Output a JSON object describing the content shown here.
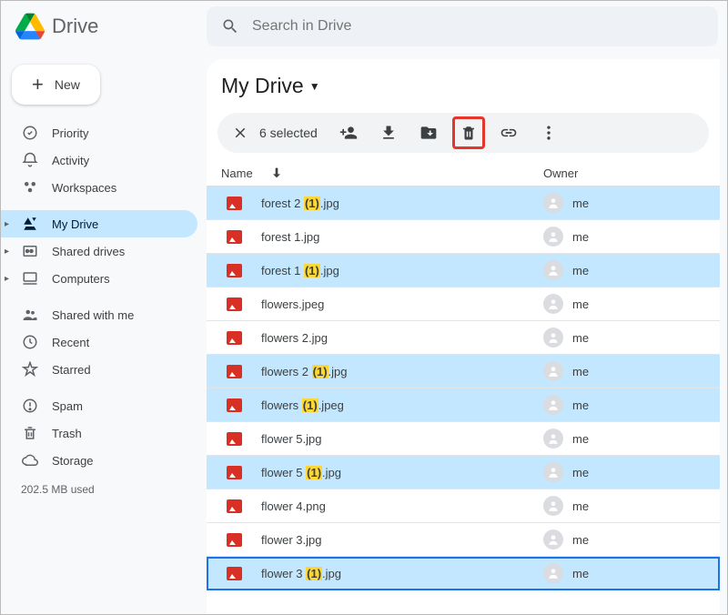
{
  "product_name": "Drive",
  "search_placeholder": "Search in Drive",
  "new_button": "New",
  "sidebar": {
    "items": [
      {
        "label": "Priority",
        "icon": "priority",
        "caret": false,
        "active": false
      },
      {
        "label": "Activity",
        "icon": "activity",
        "caret": false,
        "active": false
      },
      {
        "label": "Workspaces",
        "icon": "workspaces",
        "caret": false,
        "active": false
      },
      {
        "label": "My Drive",
        "icon": "mydrive",
        "caret": true,
        "active": true
      },
      {
        "label": "Shared drives",
        "icon": "shareddrives",
        "caret": true,
        "active": false
      },
      {
        "label": "Computers",
        "icon": "computers",
        "caret": true,
        "active": false
      },
      {
        "label": "Shared with me",
        "icon": "shared",
        "caret": false,
        "active": false
      },
      {
        "label": "Recent",
        "icon": "recent",
        "caret": false,
        "active": false
      },
      {
        "label": "Starred",
        "icon": "starred",
        "caret": false,
        "active": false
      },
      {
        "label": "Spam",
        "icon": "spam",
        "caret": false,
        "active": false
      },
      {
        "label": "Trash",
        "icon": "trash",
        "caret": false,
        "active": false
      },
      {
        "label": "Storage",
        "icon": "storage",
        "caret": false,
        "active": false
      }
    ],
    "storage_used": "202.5 MB used"
  },
  "page_title": "My Drive",
  "selection_bar": {
    "count_label": "6 selected"
  },
  "columns": {
    "name": "Name",
    "owner": "Owner"
  },
  "owner_self": "me",
  "files": [
    {
      "name_pre": "forest 2 ",
      "dup": "(1)",
      "name_post": ".jpg",
      "selected": true,
      "last": false
    },
    {
      "name_pre": "forest 1.jpg",
      "dup": "",
      "name_post": "",
      "selected": false,
      "last": false
    },
    {
      "name_pre": "forest 1 ",
      "dup": "(1)",
      "name_post": ".jpg",
      "selected": true,
      "last": false
    },
    {
      "name_pre": "flowers.jpeg",
      "dup": "",
      "name_post": "",
      "selected": false,
      "last": false
    },
    {
      "name_pre": "flowers 2.jpg",
      "dup": "",
      "name_post": "",
      "selected": false,
      "last": false
    },
    {
      "name_pre": "flowers 2 ",
      "dup": "(1)",
      "name_post": ".jpg",
      "selected": true,
      "last": false
    },
    {
      "name_pre": "flowers ",
      "dup": "(1)",
      "name_post": ".jpeg",
      "selected": true,
      "last": false
    },
    {
      "name_pre": "flower 5.jpg",
      "dup": "",
      "name_post": "",
      "selected": false,
      "last": false
    },
    {
      "name_pre": "flower 5 ",
      "dup": "(1)",
      "name_post": ".jpg",
      "selected": true,
      "last": false
    },
    {
      "name_pre": "flower 4.png",
      "dup": "",
      "name_post": "",
      "selected": false,
      "last": false
    },
    {
      "name_pre": "flower 3.jpg",
      "dup": "",
      "name_post": "",
      "selected": false,
      "last": false
    },
    {
      "name_pre": "flower 3 ",
      "dup": "(1)",
      "name_post": ".jpg",
      "selected": true,
      "last": true
    }
  ]
}
